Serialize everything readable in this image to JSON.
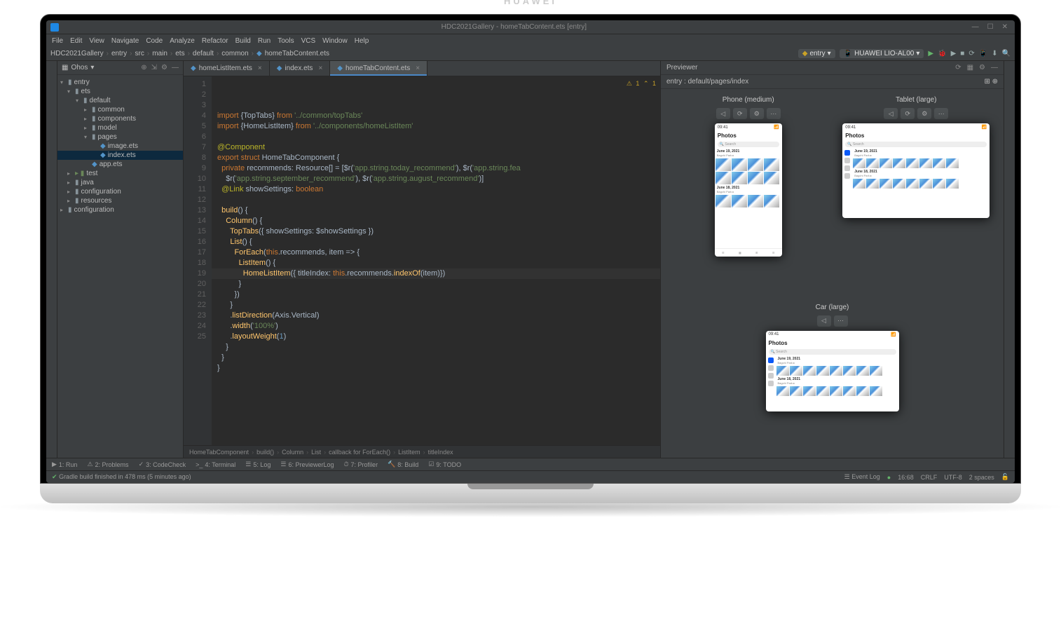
{
  "window": {
    "title": "HDC2021Gallery - homeTabContent.ets [entry]",
    "brand": "HUAWEI"
  },
  "menu": {
    "items": [
      "File",
      "Edit",
      "View",
      "Navigate",
      "Code",
      "Analyze",
      "Refactor",
      "Build",
      "Run",
      "Tools",
      "VCS",
      "Window",
      "Help"
    ]
  },
  "breadcrumbs": {
    "parts": [
      "HDC2021Gallery",
      "entry",
      "src",
      "main",
      "ets",
      "default",
      "common",
      "homeTabContent.ets"
    ]
  },
  "run": {
    "config": "entry",
    "device": "HUAWEI LIO-AL00"
  },
  "project": {
    "header": "Ohos",
    "tree": [
      {
        "name": "entry",
        "indent": 0,
        "type": "module",
        "open": true
      },
      {
        "name": "ets",
        "indent": 1,
        "type": "folder",
        "open": true
      },
      {
        "name": "default",
        "indent": 2,
        "type": "folder",
        "open": true
      },
      {
        "name": "common",
        "indent": 3,
        "type": "folder"
      },
      {
        "name": "components",
        "indent": 3,
        "type": "folder"
      },
      {
        "name": "model",
        "indent": 3,
        "type": "folder"
      },
      {
        "name": "pages",
        "indent": 3,
        "type": "folder",
        "open": true
      },
      {
        "name": "image.ets",
        "indent": 4,
        "type": "file"
      },
      {
        "name": "index.ets",
        "indent": 4,
        "type": "file",
        "selected": true
      },
      {
        "name": "app.ets",
        "indent": 3,
        "type": "file"
      },
      {
        "name": "test",
        "indent": 1,
        "type": "folder-green"
      },
      {
        "name": "java",
        "indent": 1,
        "type": "folder"
      },
      {
        "name": "configuration",
        "indent": 1,
        "type": "folder"
      },
      {
        "name": "resources",
        "indent": 1,
        "type": "folder"
      },
      {
        "name": "configuration",
        "indent": 0,
        "type": "folder"
      }
    ]
  },
  "tabs": [
    {
      "label": "homeListItem.ets",
      "active": false
    },
    {
      "label": "index.ets",
      "active": false
    },
    {
      "label": "homeTabContent.ets",
      "active": true
    }
  ],
  "code": {
    "lines": [
      {
        "n": 1,
        "html": "<span class='k'>import</span> {TopTabs} <span class='k'>from</span> <span class='s'>'../common/topTabs'</span>"
      },
      {
        "n": 2,
        "html": "<span class='k'>import</span> {HomeListItem} <span class='k'>from</span> <span class='s'>'../components/homeListItem'</span>"
      },
      {
        "n": 3,
        "html": ""
      },
      {
        "n": 4,
        "html": "<span class='d'>@Component</span>"
      },
      {
        "n": 5,
        "html": "<span class='k'>export struct</span> <span class='t'>HomeTabComponent</span> {"
      },
      {
        "n": 6,
        "html": "  <span class='k'>private</span> recommends: <span class='t'>Resource</span>[] = [$r(<span class='s'>'app.string.today_recommend'</span>), $r(<span class='s'>'app.string.fea</span>"
      },
      {
        "n": 7,
        "html": "    $r(<span class='s'>'app.string.september_recommend'</span>), $r(<span class='s'>'app.string.august_recommend'</span>)]"
      },
      {
        "n": 8,
        "html": "  <span class='d'>@Link</span> showSettings: <span class='k'>boolean</span>"
      },
      {
        "n": 9,
        "html": ""
      },
      {
        "n": 10,
        "html": "  <span class='f'>build</span>() {"
      },
      {
        "n": 11,
        "html": "    <span class='f'>Column</span>() {"
      },
      {
        "n": 12,
        "html": "      <span class='f'>TopTabs</span>({ showSettings: $showSettings })"
      },
      {
        "n": 13,
        "html": "      <span class='f'>List</span>() {"
      },
      {
        "n": 14,
        "html": "<span class='breakpoint'></span>        <span class='f'>ForEach</span>(<span class='k'>this</span>.recommends, item => {",
        "bp": true
      },
      {
        "n": 15,
        "html": "          <span class='f'>ListItem</span>() {"
      },
      {
        "n": 16,
        "html": "            <span class='f'>HomeListItem</span>({ titleIndex: <span class='k'>this</span>.recommends.<span class='f'>indexOf</span>(item<span class='t'>)</span>})",
        "hl": true
      },
      {
        "n": 17,
        "html": "          }"
      },
      {
        "n": 18,
        "html": "        })"
      },
      {
        "n": 19,
        "html": "      }"
      },
      {
        "n": 20,
        "html": "      .<span class='f'>listDirection</span>(Axis.Vertical)"
      },
      {
        "n": 21,
        "html": "      .<span class='f'>width</span>(<span class='s'>'100%'</span>)"
      },
      {
        "n": 22,
        "html": "      .<span class='f'>layoutWeight</span>(<span class='n'>1</span>)"
      },
      {
        "n": 23,
        "html": "    }"
      },
      {
        "n": 24,
        "html": "  }"
      },
      {
        "n": 25,
        "html": "}"
      }
    ],
    "warnings": "1",
    "hints": "1"
  },
  "editorBreadcrumb": [
    "HomeTabComponent",
    "build()",
    "Column",
    "List",
    "callback for ForEach()",
    "ListItem",
    "titleIndex"
  ],
  "previewer": {
    "title": "Previewer",
    "entry": "entry : default/pages/index",
    "devices": [
      {
        "label": "Phone (medium)",
        "type": "phone"
      },
      {
        "label": "Tablet (large)",
        "type": "tablet"
      },
      {
        "label": "Car (large)",
        "type": "car"
      }
    ],
    "app": {
      "title": "Photos",
      "search": "Search",
      "sections": [
        {
          "date": "June 19, 2021",
          "sub": "Bagchi Park ▸"
        },
        {
          "date": "June 18, 2021",
          "sub": "Bagchi Park ▸"
        }
      ]
    }
  },
  "toolwindows": [
    "Run",
    "Problems",
    "CodeCheck",
    "Terminal",
    "Log",
    "PreviewerLog",
    "Profiler",
    "Build",
    "TODO"
  ],
  "status": {
    "left": "Gradle build finished in 478 ms (5 minutes ago)",
    "eventlog": "Event Log",
    "pos": "16:68",
    "sep": "CRLF",
    "enc": "UTF-8",
    "indent": "2 spaces"
  }
}
